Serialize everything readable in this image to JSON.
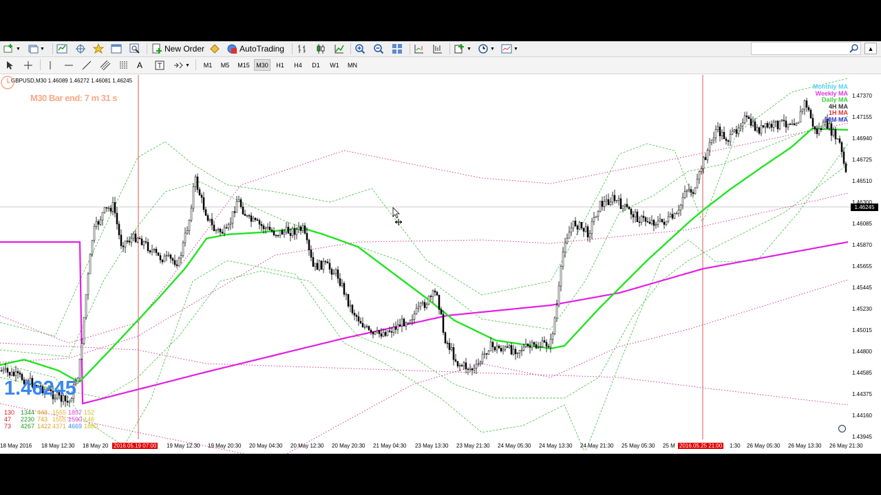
{
  "toolbar": {
    "new_order_label": "New Order",
    "autotrading_label": "AutoTrading",
    "timeframes": [
      "M1",
      "M5",
      "M15",
      "M30",
      "H1",
      "H4",
      "D1",
      "W1",
      "MN"
    ],
    "active_timeframe": "M30",
    "search_placeholder": ""
  },
  "chart": {
    "symbol_info": "GBPUSD,M30  1.46089 1.46272 1.46081 1.46245",
    "bar_end_text": "M30 Bar end: 7 m 31 s",
    "current_price": "1.46245",
    "big_price": "1.46245",
    "price_labels": [
      "1.47370",
      "1.47155",
      "1.46940",
      "1.46725",
      "1.46510",
      "1.46300",
      "1.46085",
      "1.45870",
      "1.45655",
      "1.45445",
      "1.45230",
      "1.45015",
      "1.44800",
      "1.44585",
      "1.44375",
      "1.44160",
      "1.43945"
    ],
    "time_labels": [
      "18 May 2016",
      "18 May 12:30",
      "18 May 20",
      "2016.05.19 07:00",
      "19 May 12:30",
      "19 May 20:30",
      "20 May 04:30",
      "20 May 12:30",
      "20 May 20:30",
      "21 May 04:30",
      "23 May 13:30",
      "23 May 21:30",
      "24 May 05:30",
      "24 May 13:30",
      "24 May 21:30",
      "25 May 05:30",
      "25 M",
      "2016.05.25 21:00",
      "1:30",
      "26 May 05:30",
      "26 May 13:30",
      "26 May 21:30"
    ],
    "legend": [
      {
        "label": "Monthly MA",
        "color": "#4fd6ee"
      },
      {
        "label": "Weekly MA",
        "color": "#e23ae2"
      },
      {
        "label": "Daily MA",
        "color": "#38d238"
      },
      {
        "label": "4H MA",
        "color": "#333333"
      },
      {
        "label": "1H MA",
        "color": "#e03030"
      },
      {
        "label": "30M MA",
        "color": "#3a3ad0"
      }
    ],
    "stats": [
      {
        "row": [
          "130",
          "1344",
          "448",
          "1555",
          "1857",
          "152"
        ]
      },
      {
        "row": [
          "47",
          "2230",
          "743",
          "1555",
          "1590",
          "146"
        ]
      },
      {
        "row": [
          "73",
          "4267",
          "1422",
          "4371",
          "4669",
          "1880"
        ]
      }
    ],
    "colors": {
      "daily_ma": "#22e322",
      "weekly_ma": "#e31ee3",
      "bands": "#3ab83a",
      "weekly_bands": "#cc2288",
      "vline": "#d23030",
      "candles": "#000000"
    }
  }
}
